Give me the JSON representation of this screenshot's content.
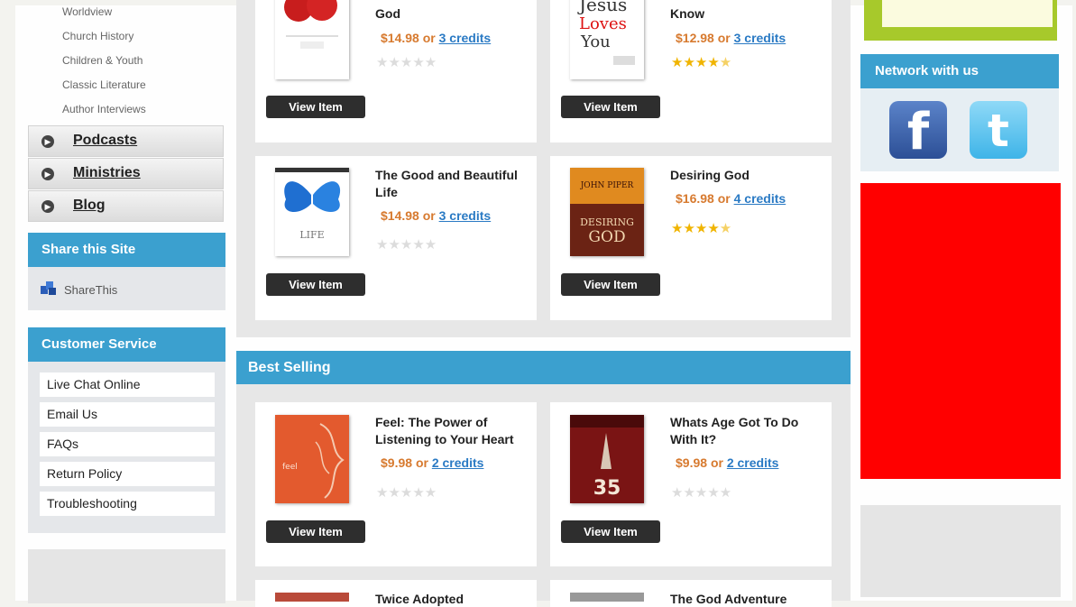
{
  "left": {
    "sublinks": [
      "Worldview",
      "Church History",
      "Children & Youth",
      "Classic Literature",
      "Author Interviews"
    ],
    "nav": [
      "Podcasts",
      "Ministries",
      "Blog"
    ],
    "share": {
      "title": "Share this Site",
      "label": "ShareThis"
    },
    "customer_service": {
      "title": "Customer Service",
      "items": [
        "Live Chat Online",
        "Email Us",
        "FAQs",
        "Return Policy",
        "Troubleshooting"
      ]
    }
  },
  "main": {
    "rows": [
      [
        {
          "title": "God",
          "price": "$14.98",
          "or": "or",
          "credits": "3 credits",
          "rating": 0,
          "button": "View Item",
          "cover": "red-balloons"
        },
        {
          "title": "Know",
          "price": "$12.98",
          "or": "or",
          "credits": "3 credits",
          "rating": 4.5,
          "button": "View Item",
          "cover": "jesus-loves-you",
          "cover_text": "Jesus Loves You"
        }
      ],
      [
        {
          "title": "The Good and Beautiful Life",
          "price": "$14.98",
          "or": "or",
          "credits": "3 credits",
          "rating": 0,
          "button": "View Item",
          "cover": "blue-butterfly",
          "cover_text": "LIFE"
        },
        {
          "title": "Desiring God",
          "price": "$16.98",
          "or": "or",
          "credits": "4 credits",
          "rating": 4.5,
          "button": "View Item",
          "cover": "desiring-god",
          "cover_text": "JOHN PIPER DESIRING GOD"
        }
      ]
    ],
    "best_selling": {
      "title": "Best Selling",
      "items": [
        {
          "title": "Feel: The Power of Listening to Your Heart",
          "price": "$9.98",
          "or": "or",
          "credits": "2 credits",
          "rating": 0,
          "button": "View Item",
          "cover": "feel-orange"
        },
        {
          "title": "Whats Age Got To Do With It?",
          "price": "$9.98",
          "or": "or",
          "credits": "2 credits",
          "rating": 0,
          "button": "View Item",
          "cover": "whats-age",
          "cover_text": "35"
        }
      ],
      "partial_titles": [
        "Twice Adopted",
        "The God Adventure"
      ]
    }
  },
  "right": {
    "network": {
      "title": "Network with us",
      "icons": [
        "facebook-icon",
        "twitter-icon"
      ]
    }
  },
  "colors": {
    "accent": "#3ba0cf",
    "price": "#d77a2f",
    "link": "#2a7ac4",
    "star": "#f0b400"
  }
}
